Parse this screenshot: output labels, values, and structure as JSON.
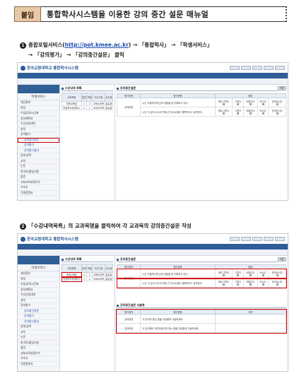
{
  "title": {
    "tag": "붙임",
    "text": "통합학사시스템을 이용한 강의 중간 설문 매뉴얼"
  },
  "step1": {
    "num": "1",
    "line1_pre": "종합포털서비스(",
    "url": "http://pot.kmee.ac.kr",
    "line1_post": ") → 「통합학사」 → 「학생서비스」",
    "line2": "→ 「강의평가」 → 「강의중간설문」 클릭"
  },
  "step2": {
    "num": "2",
    "text": "「수강내역목록」의 교과목명을 클릭하여 각 교과목의 강의중간설문 작성"
  },
  "screenshot": {
    "logo": "한국교원대학교 통합학사시스템",
    "side_header": "학생서비스",
    "side_title": "학생서비스",
    "side_items": [
      "개인정보",
      "학적",
      "수업/강의시간표",
      "강의계획서",
      "수강신청내역",
      "성적",
      "강의평가",
      "강의중간설문",
      "강의평가",
      "강의평가결과",
      "등록/장학",
      "교직",
      "논문",
      "외국어/졸업시험",
      "졸업",
      "사회교육과정이수",
      "기숙사",
      "각종증명서"
    ],
    "course_panel_title": "수강내역 목록",
    "course_headers": [
      "교과목명",
      "분반",
      "학점",
      "이수구분",
      "교수명"
    ],
    "course_row": [
      "대학교육론",
      "1",
      "3",
      "교육교과목",
      "홍길동"
    ],
    "course_row2": [
      "학생지도와세미나",
      "1",
      "2",
      "교육교과목",
      "홍길동"
    ],
    "eval_panel_title": "강의중간설문",
    "eval_headers": [
      "평가영역",
      "평가문항",
      "응답"
    ],
    "eval_area": "강의운영",
    "eval_q1": "나는 자발적이며 강의 내용을 잘 이해하고 있다.",
    "eval_q2": "나는 이 강의 교수의 학생 간 의사소통이 원활하다고 생각한다.",
    "scale": [
      "매우그렇다",
      "그렇다",
      "보통이다",
      "아니다",
      "전혀아니다"
    ],
    "save_label": "저장",
    "opinion_panel_title": "강의중간설문 서술형",
    "opinion_headers": [
      "평가영역",
      "평가문항",
      "의견"
    ],
    "opinion_area": "강의운영",
    "opinion_q1": "이 강의의 좋은 점을 자유롭게 기술하세요.",
    "opinion_q2": "이 강의에서 개선되었으면 하는 점을 자유롭게 기술하세요."
  }
}
